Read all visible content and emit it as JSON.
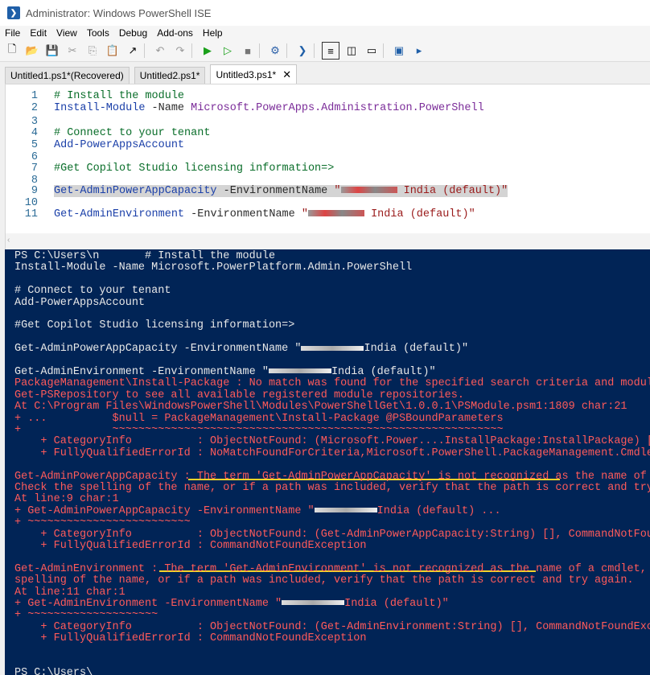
{
  "window": {
    "title": "Administrator: Windows PowerShell ISE",
    "icon": "powershell-icon"
  },
  "menu": [
    "File",
    "Edit",
    "View",
    "Tools",
    "Debug",
    "Add-ons",
    "Help"
  ],
  "toolbar": [
    "new-icon",
    "open-icon",
    "save-icon",
    "cut-icon",
    "copy-icon",
    "paste-icon",
    "clear-icon",
    "undo-icon",
    "redo-icon",
    "run-icon",
    "run-selection-icon",
    "stop-icon",
    "remote-icon",
    "console-icon",
    "layout-top-icon",
    "layout-side-icon",
    "layout-max-icon",
    "snippet-icon",
    "addon-icon"
  ],
  "tabs": [
    {
      "label": "Untitled1.ps1*(Recovered)"
    },
    {
      "label": "Untitled2.ps1*"
    },
    {
      "label": "Untitled3.ps1*"
    }
  ],
  "editor": {
    "lines": [
      {
        "n": "1",
        "comment": "# Install the module"
      },
      {
        "n": "2",
        "cmd": "Install-Module",
        "param": "-Name",
        "arg": "Microsoft.PowerApps.Administration.PowerShell"
      },
      {
        "n": "3"
      },
      {
        "n": "4",
        "comment": "# Connect to your tenant"
      },
      {
        "n": "5",
        "cmd": "Add-PowerAppsAccount"
      },
      {
        "n": "6"
      },
      {
        "n": "7",
        "comment": "#Get Copilot Studio licensing information=>"
      },
      {
        "n": "8"
      },
      {
        "n": "9",
        "cmd": "Get-AdminPowerAppCapacity",
        "param": "-EnvironmentName",
        "str_pre": "\"",
        "str_post": " India (default)\""
      },
      {
        "n": "10"
      },
      {
        "n": "11",
        "cmd": "Get-AdminEnvironment",
        "param": "-EnvironmentName",
        "str_pre": "\"",
        "str_post": " India (default)\""
      }
    ]
  },
  "console": {
    "lines": [
      {
        "t": "PS C:\\Users\\n",
        "t2": "       # Install the module",
        "kind": "out"
      },
      {
        "t": "Install-Module -Name Microsoft.PowerPlatform.Admin.PowerShell",
        "kind": "out"
      },
      {
        "t": "",
        "kind": "out"
      },
      {
        "t": "# Connect to your tenant",
        "kind": "out"
      },
      {
        "t": "Add-PowerAppsAccount",
        "kind": "out"
      },
      {
        "t": "",
        "kind": "out"
      },
      {
        "t": "#Get Copilot Studio licensing information=>",
        "kind": "out"
      },
      {
        "t": "",
        "kind": "out"
      },
      {
        "t": "Get-AdminPowerAppCapacity -EnvironmentName \"",
        "t2": "India (default)\"",
        "kind": "out",
        "blur": true
      },
      {
        "t": "",
        "kind": "out"
      },
      {
        "t": "Get-AdminEnvironment -EnvironmentName \"",
        "t2": "India (default)\"",
        "kind": "out",
        "blur": true
      },
      {
        "t": "PackageManagement\\Install-Package : No match was found for the specified search criteria and module",
        "kind": "err"
      },
      {
        "t": "Get-PSRepository to see all available registered module repositories.",
        "kind": "err"
      },
      {
        "t": "At C:\\Program Files\\WindowsPowerShell\\Modules\\PowerShellGet\\1.0.0.1\\PSModule.psm1:1809 char:21",
        "kind": "err"
      },
      {
        "t": "+ ...          $null = PackageManagement\\Install-Package @PSBoundParameters",
        "kind": "err"
      },
      {
        "t": "+              ~~~~~~~~~~~~~~~~~~~~~~~~~~~~~~~~~~~~~~~~~~~~~~~~~~~~~~~~~~~~",
        "kind": "err"
      },
      {
        "t": "    + CategoryInfo          : ObjectNotFound: (Microsoft.Power....InstallPackage:InstallPackage) [In",
        "kind": "err"
      },
      {
        "t": "    + FullyQualifiedErrorId : NoMatchFoundForCriteria,Microsoft.PowerShell.PackageManagement.Cmdlets",
        "kind": "err"
      },
      {
        "t": "",
        "kind": "err"
      },
      {
        "t": "Get-AdminPowerAppCapacity : The term 'Get-AdminPowerAppCapacity' is not recognized as the name of a",
        "kind": "err"
      },
      {
        "t": "Check the spelling of the name, or if a path was included, verify that the path is correct and try a",
        "kind": "err"
      },
      {
        "t": "At line:9 char:1",
        "kind": "err"
      },
      {
        "t": "+ Get-AdminPowerAppCapacity -EnvironmentName \"",
        "t2": "India (default) ...",
        "kind": "err",
        "blur": true
      },
      {
        "t": "+ ~~~~~~~~~~~~~~~~~~~~~~~~~",
        "kind": "err"
      },
      {
        "t": "    + CategoryInfo          : ObjectNotFound: (Get-AdminPowerAppCapacity:String) [], CommandNotFound",
        "kind": "err"
      },
      {
        "t": "    + FullyQualifiedErrorId : CommandNotFoundException",
        "kind": "err"
      },
      {
        "t": "",
        "kind": "err"
      },
      {
        "t": "Get-AdminEnvironment : The term 'Get-AdminEnvironment' is not recognized as the name of a cmdlet, fu",
        "kind": "err"
      },
      {
        "t": "spelling of the name, or if a path was included, verify that the path is correct and try again.",
        "kind": "err"
      },
      {
        "t": "At line:11 char:1",
        "kind": "err"
      },
      {
        "t": "+ Get-AdminEnvironment -EnvironmentName \"",
        "t2": "India (default)\"",
        "kind": "err",
        "blur": true
      },
      {
        "t": "+ ~~~~~~~~~~~~~~~~~~~~",
        "kind": "err"
      },
      {
        "t": "    + CategoryInfo          : ObjectNotFound: (Get-AdminEnvironment:String) [], CommandNotFoundExcep",
        "kind": "err"
      },
      {
        "t": "    + FullyQualifiedErrorId : CommandNotFoundException",
        "kind": "err"
      },
      {
        "t": "",
        "kind": "err"
      },
      {
        "t": "",
        "kind": "err"
      },
      {
        "t": "PS C:\\Users\\",
        "kind": "out"
      }
    ]
  },
  "colors": {
    "console_bg": "#012456",
    "error": "#ff5a5a",
    "underline": "#f4d22a"
  }
}
